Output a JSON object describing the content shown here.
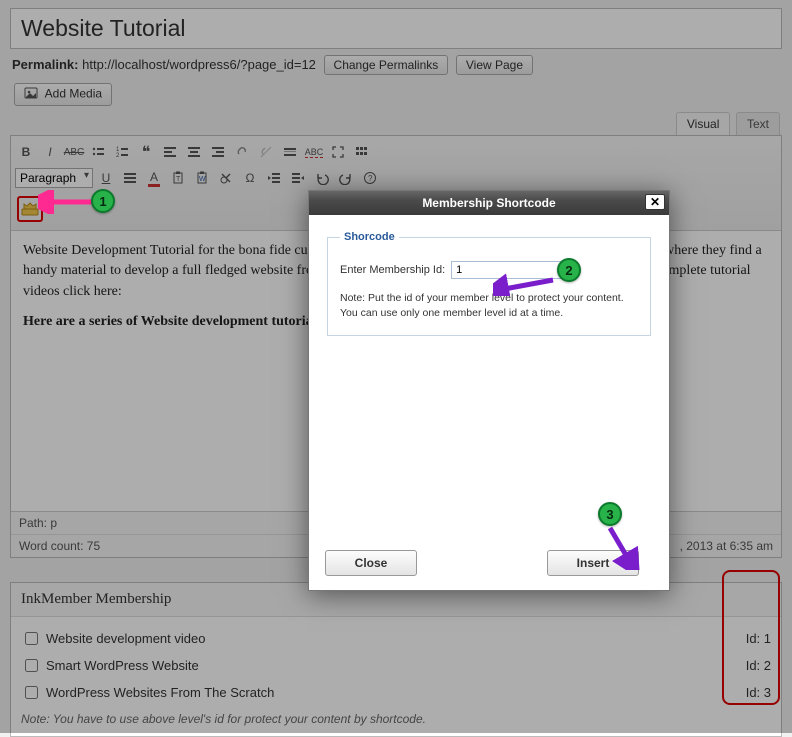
{
  "title": "Website Tutorial",
  "permalink": {
    "label": "Permalink:",
    "url": "http://localhost/wordpress6/?page_id=12",
    "change_btn": "Change Permalinks",
    "view_btn": "View Page"
  },
  "add_media_btn": "Add Media",
  "tabs": {
    "visual": "Visual",
    "text": "Text"
  },
  "format_select": "Paragraph",
  "content": {
    "p1": "Website Development Tutorial for the bona fide customers. It contains all the exciting features for their customers where they find a handy material to develop a full fledged website from the scratch. We provide you online videos till the end. For complete tutorial videos click here:",
    "p2": "Here are a series of Website development tutorials that will help you to build your own website."
  },
  "status": {
    "path_label": "Path: p",
    "wordcount_label": "Word count: 75",
    "last_edited": ", 2013 at 6:35 am"
  },
  "metabox": {
    "title": "InkMember Membership",
    "items": [
      {
        "label": "Website development video",
        "id": "Id: 1"
      },
      {
        "label": "Smart WordPress Website",
        "id": "Id: 2"
      },
      {
        "label": "WordPress Websites From The Scratch",
        "id": "Id: 3"
      }
    ],
    "note": "Note: You have to use above level's id for protect your content by shortcode."
  },
  "modal": {
    "title": "Membership Shortcode",
    "legend": "Shorcode",
    "field_label": "Enter Membership Id:",
    "field_value": "1",
    "note": "Note: Put the id of your member level to protect your content. You can use only one member level id at a time.",
    "close": "Close",
    "insert": "Insert"
  },
  "step1": "1",
  "step2": "2",
  "step3": "3"
}
